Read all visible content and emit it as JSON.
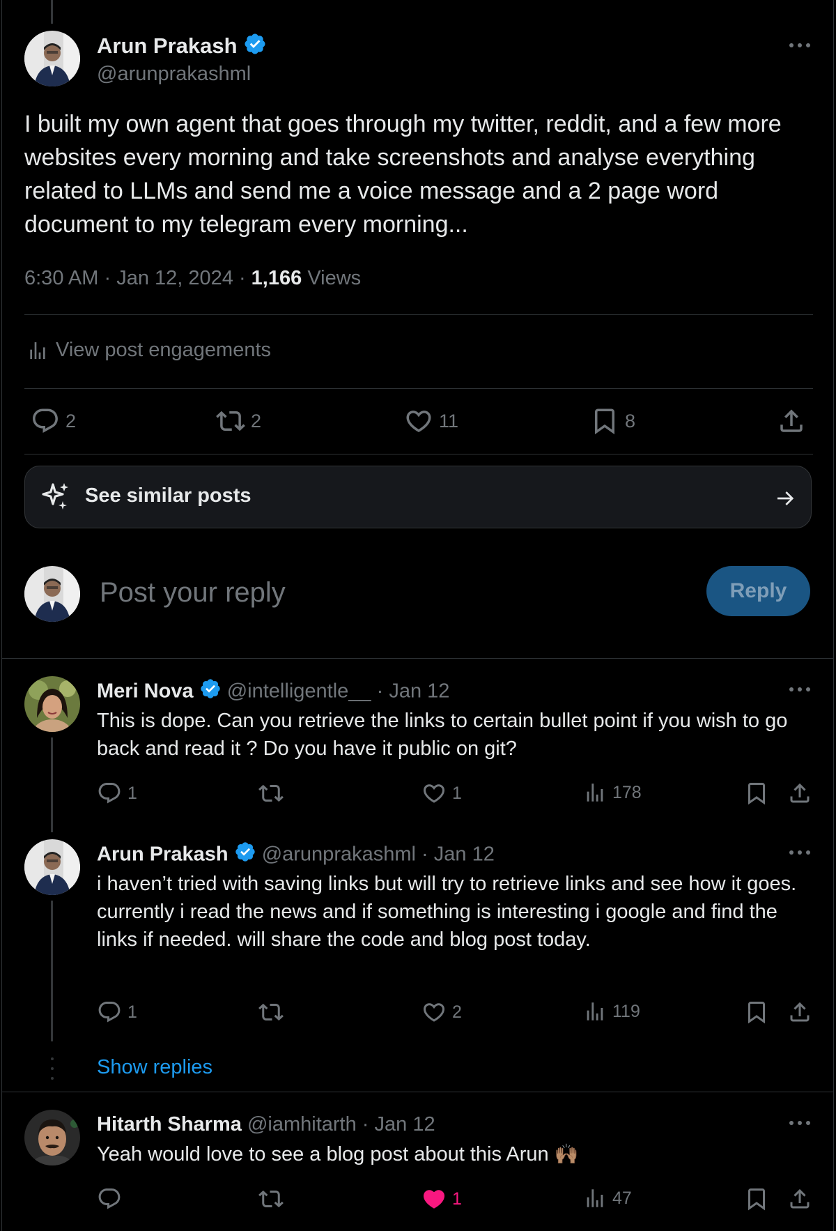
{
  "main_post": {
    "author_name": "Arun Prakash",
    "author_handle": "@arunprakashml",
    "text": "I built my own agent that goes through my twitter, reddit, and a few more websites every morning and take screenshots and analyse everything related to LLMs and send me a voice message and a 2 page word document to my telegram every morning...",
    "time": "6:30 AM",
    "date": "Jan 12, 2024",
    "views_count": "1,166",
    "views_label": "Views",
    "engagements_label": "View post engagements",
    "replies": "2",
    "reposts": "2",
    "likes": "11",
    "bookmarks": "8"
  },
  "similar": {
    "label": "See similar posts"
  },
  "composer": {
    "placeholder": "Post your reply",
    "reply_label": "Reply"
  },
  "replies": [
    {
      "name": "Meri Nova",
      "handle": "@intelligentle__",
      "date": "Jan 12",
      "text": "This is dope. Can you retrieve the links to certain bullet point if you wish to go back and read it ? Do you have it public on git?",
      "replies": "1",
      "reposts": "",
      "likes": "1",
      "views": "178"
    },
    {
      "name": "Arun Prakash",
      "handle": "@arunprakashml",
      "date": "Jan 12",
      "text1": "i haven’t tried with saving links but will try to retrieve links and see how it goes.",
      "text2": "currently i read the news and if something is interesting i google and find the links if needed. will share the code and blog post today.",
      "replies": "1",
      "reposts": "",
      "likes": "2",
      "views": "119"
    },
    {
      "name": "Hitarth Sharma",
      "handle": "@iamhitarth",
      "date": "Jan 12",
      "text": "Yeah would love to see a blog post about this Arun",
      "emoji": "🙌🏽",
      "replies": "",
      "reposts": "",
      "likes": "1",
      "views": "47"
    }
  ],
  "show_replies": "Show replies",
  "colors": {
    "accent": "#1d9bf0",
    "like": "#f91880",
    "reply_btn_bg": "#1a5583"
  }
}
